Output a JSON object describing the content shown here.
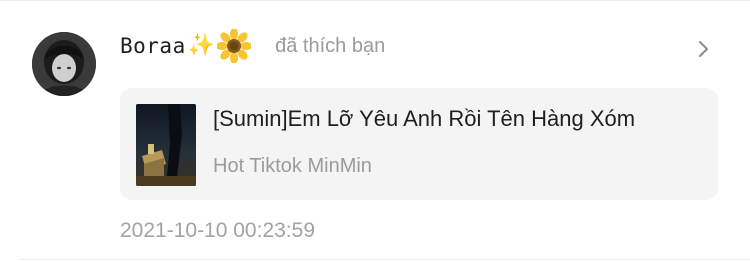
{
  "notification": {
    "user": {
      "name": "Boraa",
      "emoji_sparkles": "✨",
      "emoji_flower_icon": "sunflower-icon"
    },
    "action": "đã thích bạn",
    "chevron_icon": "chevron-right-icon",
    "song": {
      "title": "[Sumin]Em Lỡ Yêu Anh Rồi Tên Hàng Xóm",
      "artist": "Hot Tiktok MinMin",
      "thumbnail_icon": "album-art"
    },
    "timestamp": "2021-10-10 00:23:59"
  },
  "colors": {
    "card_background": "#f4f4f4",
    "muted_text": "#9b9b9b",
    "primary_text": "#1f1f1f"
  }
}
